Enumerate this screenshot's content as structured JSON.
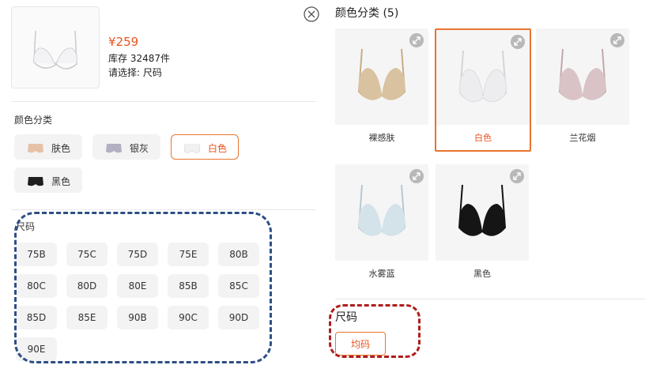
{
  "left": {
    "price": "¥259",
    "stock": "库存 32487件",
    "select_prompt": "请选择: 尺码",
    "color_section_label": "颜色分类",
    "colors": [
      {
        "label": "肤色",
        "swatch": "#e6c1a8",
        "selected": false
      },
      {
        "label": "银灰",
        "swatch": "#b3b0c2",
        "selected": false
      },
      {
        "label": "白色",
        "swatch": "#f1f1f1",
        "selected": true
      },
      {
        "label": "黑色",
        "swatch": "#1e1e1e",
        "selected": false
      }
    ],
    "size_section_label": "尺码",
    "sizes": [
      "75B",
      "75C",
      "75D",
      "75E",
      "80B",
      "80C",
      "80D",
      "80E",
      "85B",
      "85C",
      "85D",
      "85E",
      "90B",
      "90C",
      "90D",
      "90E"
    ]
  },
  "right": {
    "color_title": "颜色分类 (5)",
    "colors": [
      {
        "label": "裸感肤",
        "garment": "#d9c2a0",
        "selected": false
      },
      {
        "label": "白色",
        "garment": "#ededef",
        "selected": true
      },
      {
        "label": "兰花烟",
        "garment": "#d9c3c6",
        "selected": false
      },
      {
        "label": "水雾蓝",
        "garment": "#d4e2ea",
        "selected": false
      },
      {
        "label": "黑色",
        "garment": "#151515",
        "selected": false
      }
    ],
    "size_title": "尺码",
    "size_option": "均码"
  },
  "accent_color": "#e8541e",
  "annotation_colors": {
    "left_box": "#2d4f86",
    "right_box": "#b01c1c"
  }
}
